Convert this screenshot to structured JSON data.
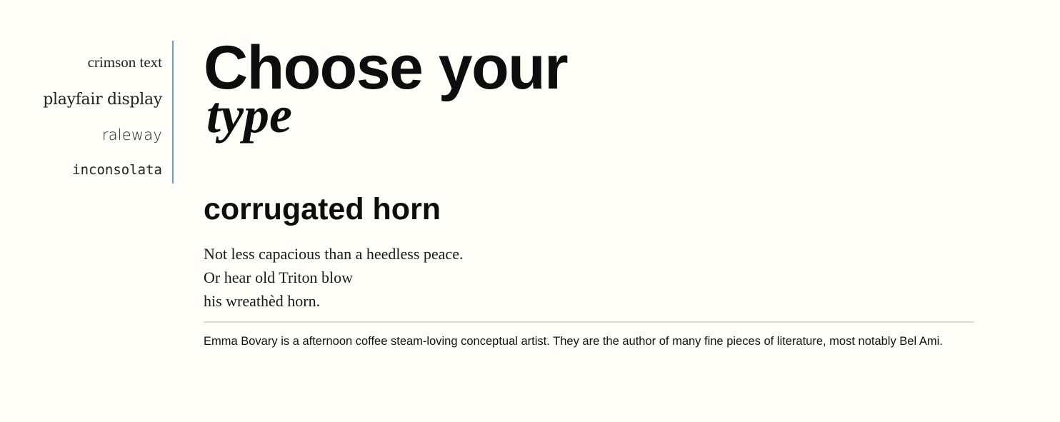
{
  "sidebar": {
    "options": [
      {
        "label": "crimson text"
      },
      {
        "label": "playfair display"
      },
      {
        "label": "raleway"
      },
      {
        "label": "inconsolata"
      }
    ]
  },
  "heading": {
    "line1": "Choose your",
    "line2": "type"
  },
  "poem": {
    "title": "corrugated horn",
    "lines": [
      "Not less capacious than a heedless peace.",
      "Or hear old Triton blow",
      "his wreathèd horn."
    ]
  },
  "bio": {
    "text": "Emma Bovary is a afternoon coffee steam-loving conceptual artist. They are the author of many fine pieces of literature, most notably Bel Ami."
  },
  "colors": {
    "background": "#fefdf8",
    "sidebar_border": "#6f9cc8",
    "divider": "#dedbd5"
  }
}
